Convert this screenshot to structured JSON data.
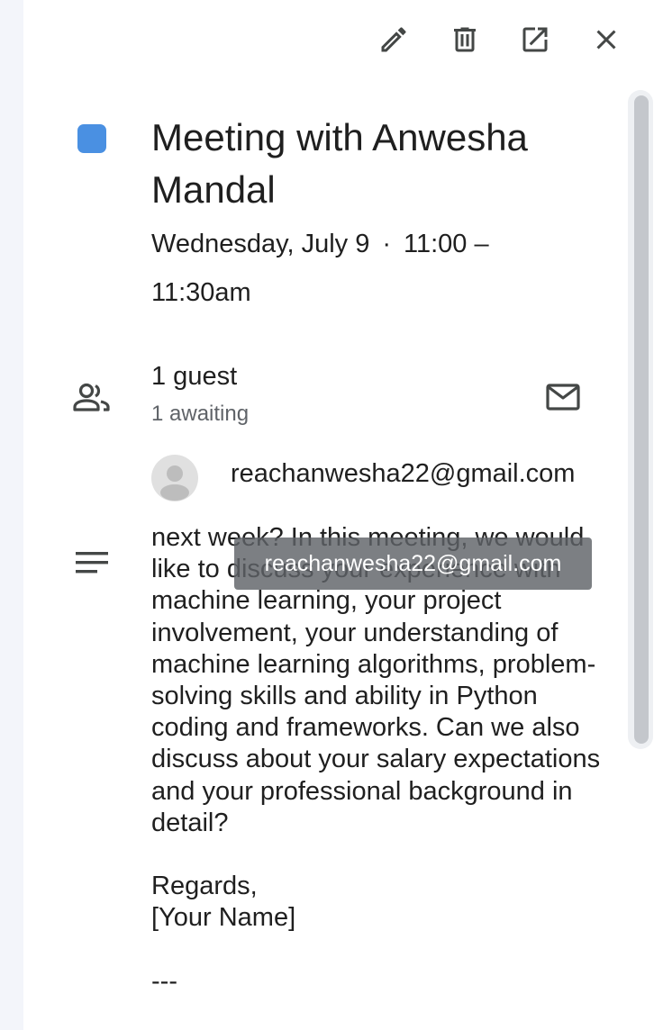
{
  "toolbar": {
    "edit_icon": "pencil-icon",
    "delete_icon": "trash-icon",
    "open_icon": "open-in-new-icon",
    "close_icon": "close-icon"
  },
  "event": {
    "color": "#4a90e2",
    "title": "Meeting with Anwesha Mandal",
    "date": "Wednesday, July 9",
    "separator": "·",
    "time": "11:00 – 11:30am"
  },
  "guests": {
    "count_label": "1 guest",
    "awaiting_label": "1 awaiting",
    "list": [
      {
        "email": "reachanwesha22@gmail.com"
      }
    ]
  },
  "description": {
    "text": "next week? In this meeting, we would like to discuss your experience with machine learning, your project involvement, your understanding of machine learning algorithms, problem-solving skills and ability in Python coding and frameworks. Can we also discuss about your salary expectations and your professional background in detail?\n\nRegards,\n[Your Name]\n\n---"
  },
  "tooltip": {
    "text": "reachanwesha22@gmail.com"
  }
}
